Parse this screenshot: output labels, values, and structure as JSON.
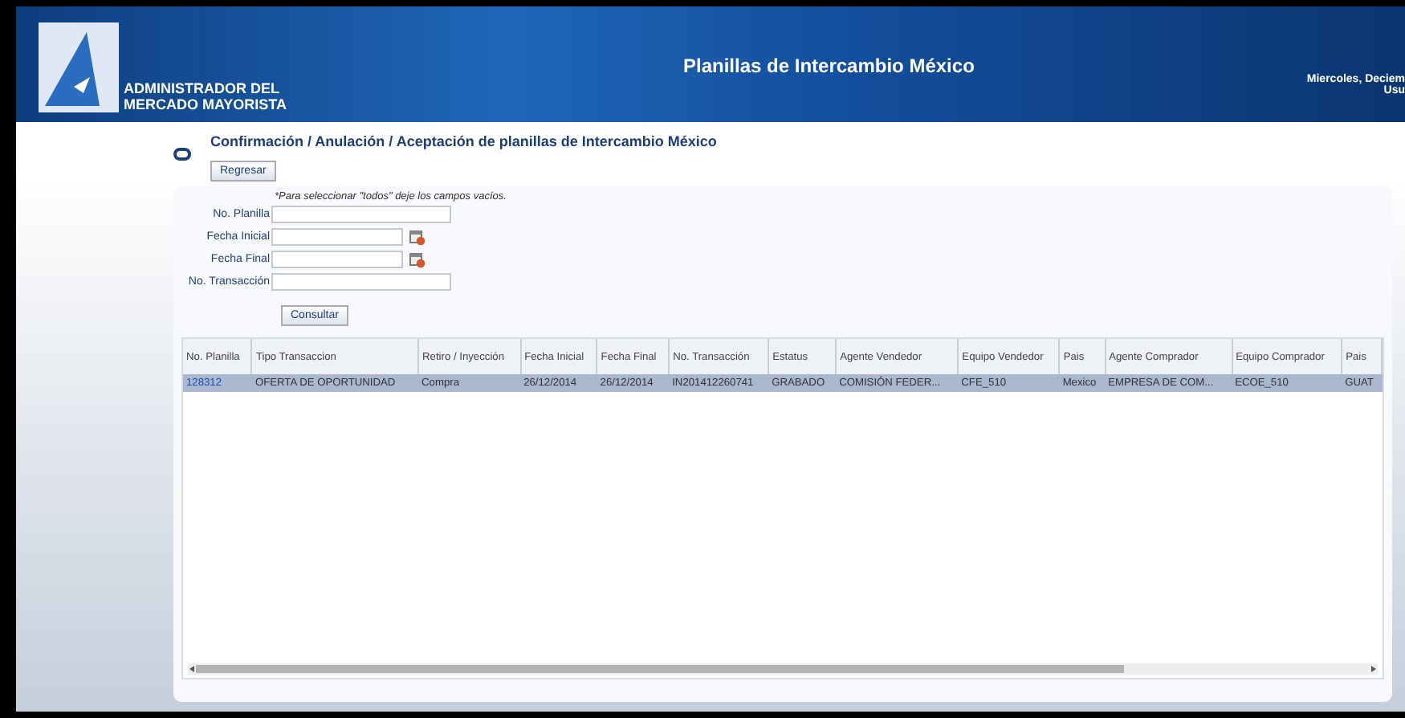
{
  "header": {
    "logo_line_1": "ADMINISTRADOR DEL",
    "logo_line_2": "MERCADO MAYORISTA",
    "title": "Planillas de Intercambio México",
    "date": "Miercoles, Deciem",
    "user": "Usu"
  },
  "page": {
    "title": "Confirmación / Anulación / Aceptación de planillas de Intercambio México",
    "back_button": "Regresar"
  },
  "form": {
    "hint": "*Para seleccionar \"todos\" deje los campos vacíos.",
    "fields": [
      {
        "label": "No. Planilla",
        "kind": "text"
      },
      {
        "label": "Fecha Inicial",
        "kind": "date"
      },
      {
        "label": "Fecha Final",
        "kind": "date"
      },
      {
        "label": "No. Transacción",
        "kind": "text"
      }
    ],
    "submit": "Consultar"
  },
  "table": {
    "columns": [
      "No. Planilla",
      "Tipo Transaccion",
      "Retiro / Inyección",
      "Fecha Inicial",
      "Fecha Final",
      "No. Transacción",
      "Estatus",
      "Agente Vendedor",
      "Equipo Vendedor",
      "Pais",
      "Agente Comprador",
      "Equipo Comprador",
      "Pais"
    ],
    "rows": [
      {
        "selected": true,
        "cells": [
          "128312",
          "OFERTA DE OPORTUNIDAD",
          "Compra",
          "26/12/2014",
          "26/12/2014",
          "IN201412260741",
          "GRABADO",
          "COMISIÓN FEDER...",
          "CFE_510",
          "Mexico",
          "EMPRESA DE COM...",
          "ECOE_510",
          "GUAT"
        ]
      }
    ]
  }
}
